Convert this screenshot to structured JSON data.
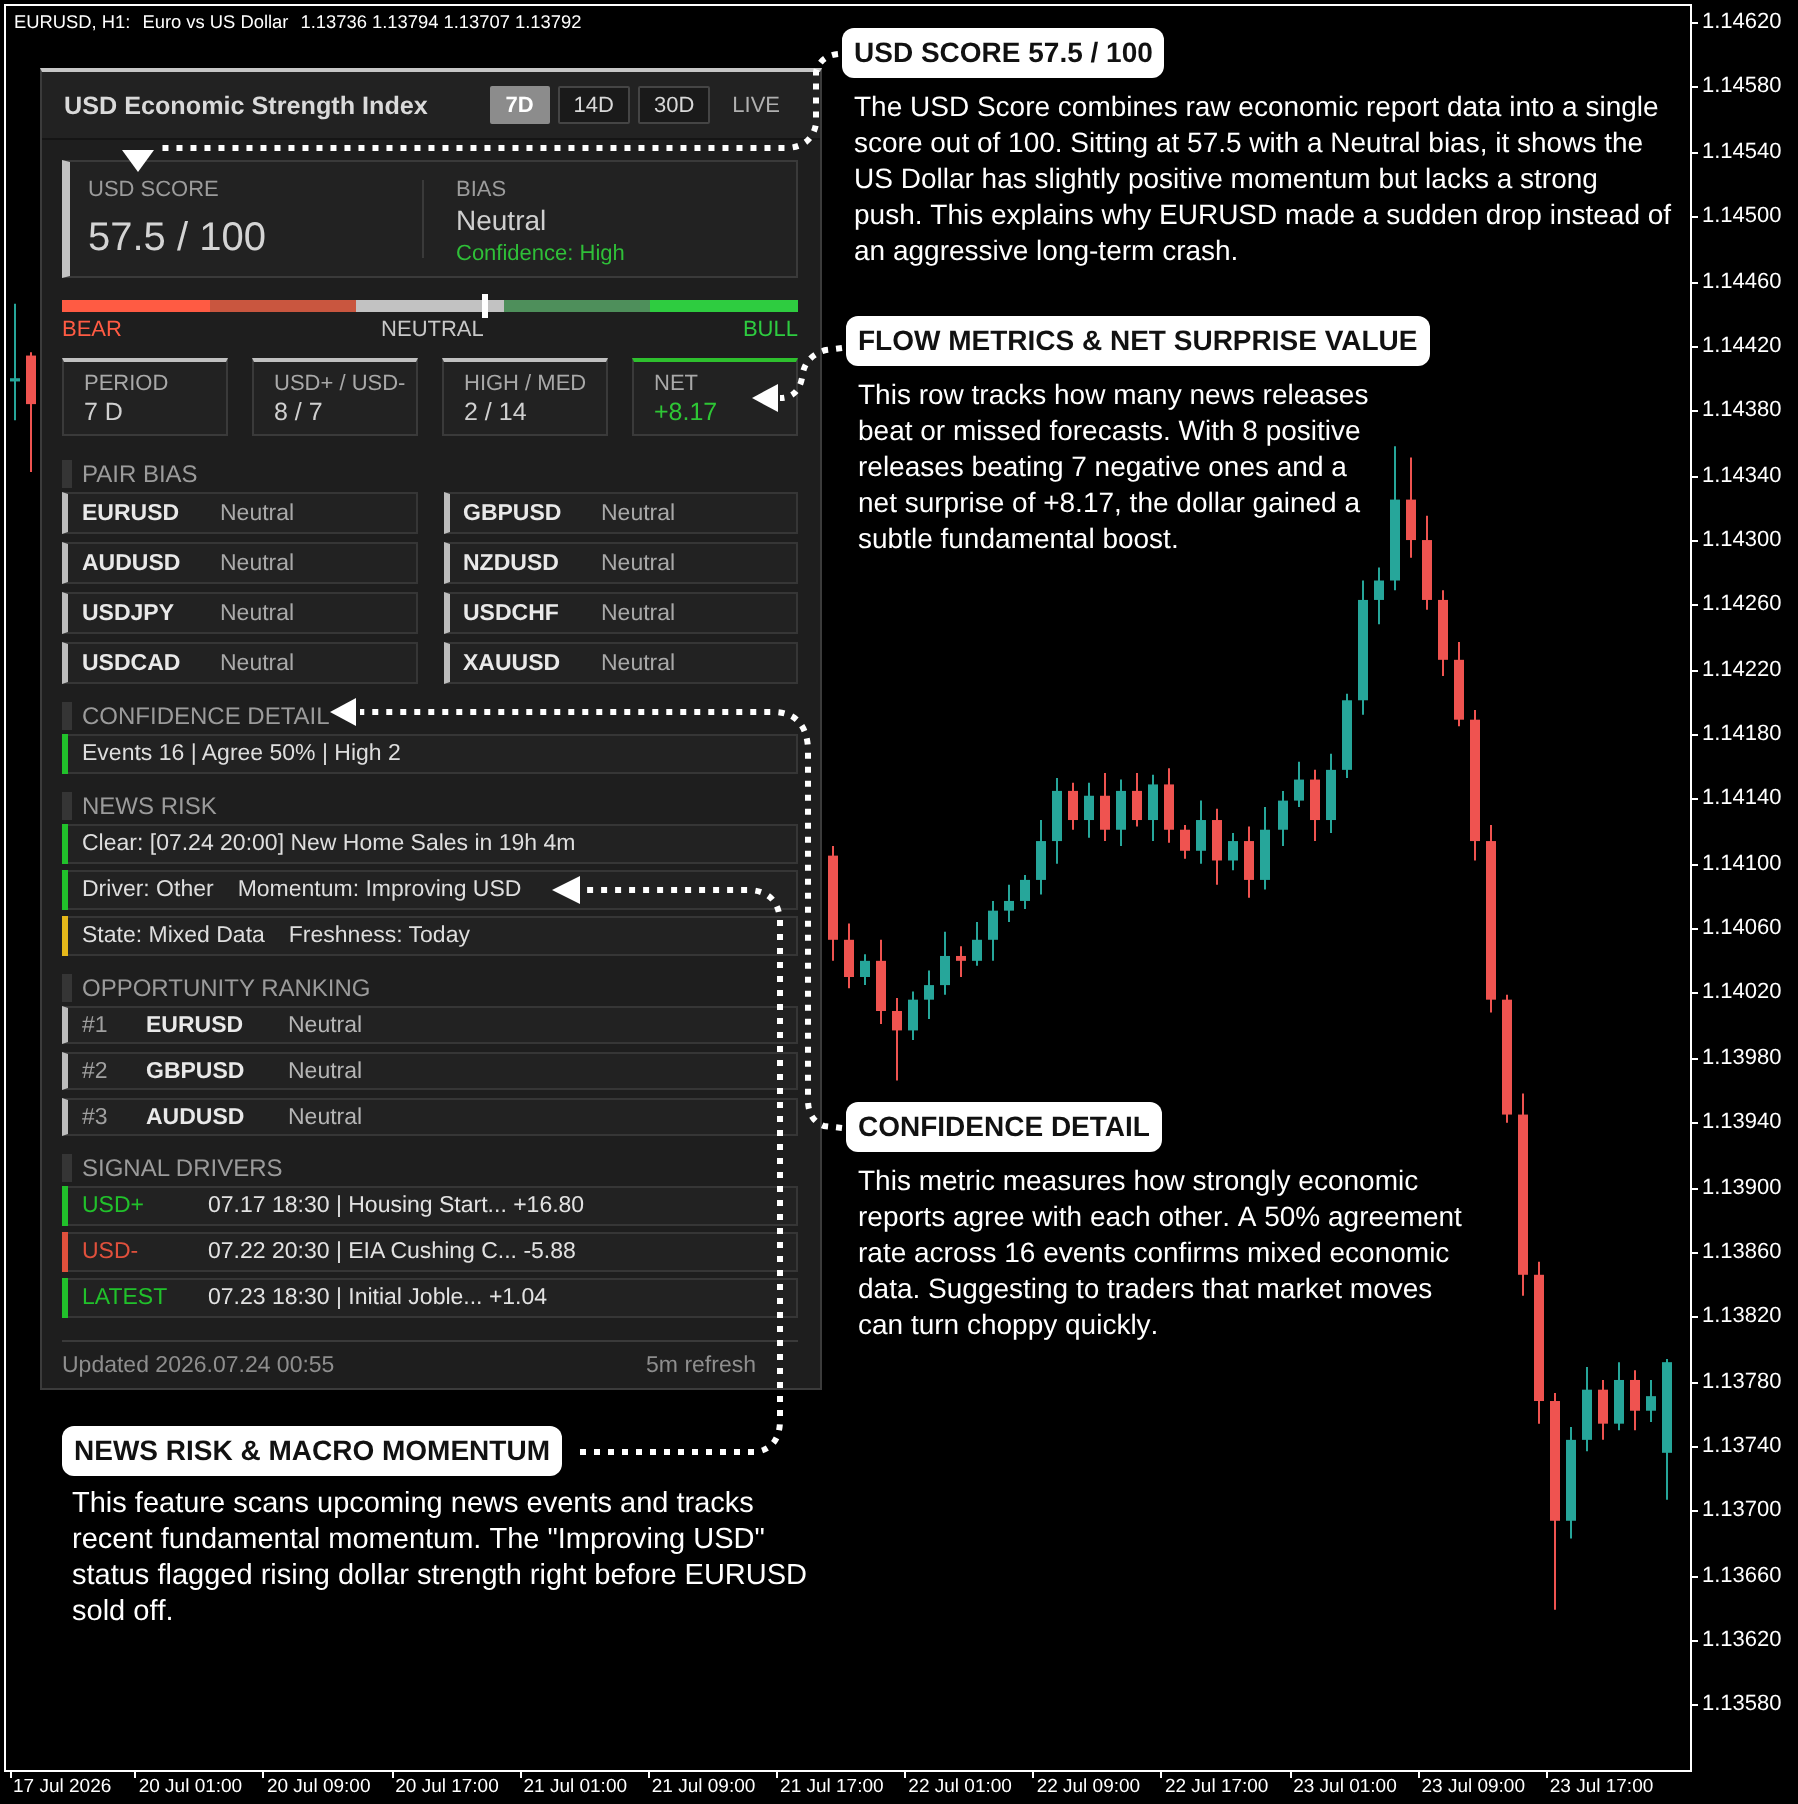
{
  "chart": {
    "symbol": "EURUSD, H1:",
    "description": "Euro vs US Dollar",
    "ohlc": "1.13736 1.13794 1.13707 1.13792",
    "chart_data": {
      "type": "candlestick",
      "categories": [
        null,
        null,
        null,
        "17 Jul 2026",
        null,
        null,
        null,
        null,
        null,
        null,
        null,
        "20 Jul 01:00",
        null,
        null,
        null,
        null,
        null,
        null,
        null,
        "20 Jul 09:00",
        null,
        null,
        null,
        null,
        null,
        null,
        null,
        "20 Jul 17:00",
        null,
        null,
        null,
        null,
        null,
        null,
        null,
        "21 Jul 01:00",
        null,
        null,
        null,
        null,
        null,
        null,
        null,
        "21 Jul 09:00",
        null,
        null,
        null,
        null,
        null,
        null,
        null,
        "21 Jul 17:00",
        null,
        null,
        null,
        null,
        null,
        null,
        null,
        "22 Jul 01:00",
        null,
        null,
        null,
        null,
        null,
        null,
        null,
        "22 Jul 09:00",
        null,
        null,
        null,
        null,
        null,
        null,
        null,
        "22 Jul 17:00",
        null,
        null,
        null,
        null,
        null,
        null,
        null,
        "23 Jul 01:00",
        null,
        null,
        null,
        null,
        null,
        null,
        null,
        "23 Jul 09:00",
        null,
        null,
        null,
        null,
        null,
        null,
        null,
        "23 Jul 17:00",
        null,
        null,
        null,
        null,
        null
      ],
      "ohlc": [
        [
          1.14398,
          1.14446,
          1.14374,
          1.144
        ],
        [
          1.14414,
          1.14416,
          1.14342,
          1.14384
        ],
        null,
        null,
        null,
        null,
        null,
        null,
        null,
        null,
        null,
        null,
        null,
        null,
        null,
        null,
        null,
        null,
        null,
        null,
        null,
        null,
        null,
        null,
        null,
        null,
        null,
        null,
        null,
        null,
        null,
        null,
        null,
        null,
        null,
        null,
        null,
        null,
        null,
        null,
        null,
        null,
        null,
        null,
        null,
        null,
        null,
        null,
        null,
        null,
        null,
        [
          1.14105,
          1.14111,
          1.1404,
          1.14053
        ],
        [
          1.14053,
          1.14063,
          1.14023,
          1.1403
        ],
        [
          1.1403,
          1.14044,
          1.14025,
          1.1404
        ],
        [
          1.1404,
          1.14053,
          1.14001,
          1.14009
        ],
        [
          1.14009,
          1.14017,
          1.13966,
          1.13997
        ],
        [
          1.13997,
          1.14021,
          1.13991,
          1.14016
        ],
        [
          1.14016,
          1.14034,
          1.14004,
          1.14025
        ],
        [
          1.14025,
          1.14058,
          1.14019,
          1.14043
        ],
        [
          1.14043,
          1.14049,
          1.1403,
          1.1404
        ],
        [
          1.1404,
          1.14064,
          1.14037,
          1.14053
        ],
        [
          1.14053,
          1.14077,
          1.1404,
          1.14071
        ],
        [
          1.14071,
          1.14087,
          1.14064,
          1.14077
        ],
        [
          1.14077,
          1.14093,
          1.14072,
          1.1409
        ],
        [
          1.1409,
          1.14127,
          1.14081,
          1.14114
        ],
        [
          1.14114,
          1.14153,
          1.141,
          1.14145
        ],
        [
          1.14145,
          1.1415,
          1.14121,
          1.14127
        ],
        [
          1.14127,
          1.1415,
          1.14116,
          1.14142
        ],
        [
          1.14142,
          1.14156,
          1.14114,
          1.14121
        ],
        [
          1.14121,
          1.14152,
          1.14111,
          1.14145
        ],
        [
          1.14145,
          1.14156,
          1.14123,
          1.14127
        ],
        [
          1.14127,
          1.14155,
          1.14114,
          1.14149
        ],
        [
          1.14149,
          1.14159,
          1.14113,
          1.14121
        ],
        [
          1.14121,
          1.14124,
          1.14103,
          1.14108
        ],
        [
          1.14108,
          1.14139,
          1.141,
          1.14127
        ],
        [
          1.14127,
          1.14134,
          1.14087,
          1.14102
        ],
        [
          1.14102,
          1.14119,
          1.14096,
          1.14114
        ],
        [
          1.14114,
          1.14123,
          1.14079,
          1.1409
        ],
        [
          1.1409,
          1.14135,
          1.14084,
          1.14121
        ],
        [
          1.14121,
          1.14145,
          1.14111,
          1.14139
        ],
        [
          1.14139,
          1.14163,
          1.14135,
          1.14152
        ],
        [
          1.14152,
          1.14158,
          1.14114,
          1.14127
        ],
        [
          1.14127,
          1.14168,
          1.14119,
          1.14158
        ],
        [
          1.14158,
          1.14205,
          1.14153,
          1.14201
        ],
        [
          1.14201,
          1.14275,
          1.14192,
          1.14263
        ],
        [
          1.14263,
          1.14283,
          1.14248,
          1.14275
        ],
        [
          1.14275,
          1.14358,
          1.14269,
          1.14325
        ],
        [
          1.14325,
          1.14351,
          1.14289,
          1.143
        ],
        [
          1.143,
          1.14315,
          1.14257,
          1.14263
        ],
        [
          1.14263,
          1.14269,
          1.14216,
          1.14226
        ],
        [
          1.14226,
          1.14237,
          1.14185,
          1.14189
        ],
        [
          1.14189,
          1.14195,
          1.14102,
          1.14114
        ],
        [
          1.14114,
          1.14124,
          1.14008,
          1.14016
        ],
        [
          1.14016,
          1.14019,
          1.1394,
          1.13945
        ],
        [
          1.13945,
          1.13958,
          1.13833,
          1.13846
        ],
        [
          1.13846,
          1.13854,
          1.13754,
          1.13768
        ],
        [
          1.13768,
          1.13773,
          1.13639,
          1.13694
        ],
        [
          1.13694,
          1.13752,
          1.13683,
          1.13744
        ],
        [
          1.13744,
          1.13789,
          1.13737,
          1.13775
        ],
        [
          1.13775,
          1.13781,
          1.13744,
          1.13754
        ],
        [
          1.13754,
          1.13792,
          1.1375,
          1.13781
        ],
        [
          1.13781,
          1.13787,
          1.1375,
          1.13762
        ],
        [
          1.13762,
          1.13781,
          1.13755,
          1.13771
        ],
        [
          1.13736,
          1.13794,
          1.13707,
          1.13792
        ],
        null
      ],
      "ylim": [
        1.1354,
        1.1463
      ],
      "yticks": [
        {
          "value": 1.1462,
          "label": "1.14620"
        },
        {
          "value": 1.1458,
          "label": "1.14580"
        },
        {
          "value": 1.1454,
          "label": "1.14540"
        },
        {
          "value": 1.145,
          "label": "1.14500"
        },
        {
          "value": 1.1446,
          "label": "1.14460"
        },
        {
          "value": 1.1442,
          "label": "1.14420"
        },
        {
          "value": 1.1438,
          "label": "1.14380"
        },
        {
          "value": 1.1434,
          "label": "1.14340"
        },
        {
          "value": 1.143,
          "label": "1.14300"
        },
        {
          "value": 1.1426,
          "label": "1.14260"
        },
        {
          "value": 1.1422,
          "label": "1.14220"
        },
        {
          "value": 1.1418,
          "label": "1.14180"
        },
        {
          "value": 1.1414,
          "label": "1.14140"
        },
        {
          "value": 1.141,
          "label": "1.14100"
        },
        {
          "value": 1.1406,
          "label": "1.14060"
        },
        {
          "value": 1.1402,
          "label": "1.14020"
        },
        {
          "value": 1.1398,
          "label": "1.13980"
        },
        {
          "value": 1.1394,
          "label": "1.13940"
        },
        {
          "value": 1.139,
          "label": "1.13900"
        },
        {
          "value": 1.1386,
          "label": "1.13860"
        },
        {
          "value": 1.1382,
          "label": "1.13820"
        },
        {
          "value": 1.1378,
          "label": "1.13780"
        },
        {
          "value": 1.1374,
          "label": "1.13740"
        },
        {
          "value": 1.137,
          "label": "1.13700"
        },
        {
          "value": 1.1366,
          "label": "1.13660"
        },
        {
          "value": 1.1362,
          "label": "1.13620"
        },
        {
          "value": 1.1358,
          "label": "1.13580"
        }
      ]
    }
  },
  "panel": {
    "title": "USD Economic Strength Index",
    "ranges": [
      {
        "label": "7D",
        "selected": true
      },
      {
        "label": "14D",
        "selected": false
      },
      {
        "label": "30D",
        "selected": false
      }
    ],
    "live": "LIVE",
    "score": {
      "label": "USD SCORE",
      "value": "57.5 / 100"
    },
    "bias": {
      "label": "BIAS",
      "value": "Neutral",
      "confidence": "Confidence: High"
    },
    "gauge": {
      "level": 0.575,
      "bear": "BEAR",
      "neutral": "NEUTRAL",
      "bull": "BULL"
    },
    "metrics": [
      {
        "label": "PERIOD",
        "value": "7 D",
        "kind": "plain"
      },
      {
        "label": "USD+ / USD-",
        "value": "8 / 7",
        "kind": "plain"
      },
      {
        "label": "HIGH / MED",
        "value": "2 / 14",
        "kind": "plain"
      },
      {
        "label": "NET",
        "value": "+8.17",
        "kind": "positive"
      }
    ],
    "pair_bias": {
      "heading": "PAIR BIAS",
      "pairs": [
        {
          "pair": "EURUSD",
          "bias": "Neutral"
        },
        {
          "pair": "GBPUSD",
          "bias": "Neutral"
        },
        {
          "pair": "AUDUSD",
          "bias": "Neutral"
        },
        {
          "pair": "NZDUSD",
          "bias": "Neutral"
        },
        {
          "pair": "USDJPY",
          "bias": "Neutral"
        },
        {
          "pair": "USDCHF",
          "bias": "Neutral"
        },
        {
          "pair": "USDCAD",
          "bias": "Neutral"
        },
        {
          "pair": "XAUUSD",
          "bias": "Neutral"
        }
      ]
    },
    "confidence_detail": {
      "heading": "CONFIDENCE DETAIL",
      "rows": [
        {
          "texts": [
            "Events 16 | Agree 50% | High 2"
          ],
          "color": "#21c12b"
        }
      ]
    },
    "news_risk": {
      "heading": "NEWS RISK",
      "rows": [
        {
          "texts": [
            "Clear: [07.24 20:00] New Home Sales in 19h 4m"
          ],
          "color": "#21c12b"
        },
        {
          "texts": [
            "Driver: Other",
            "Momentum: Improving USD"
          ],
          "color": "#21c12b"
        },
        {
          "texts": [
            "State: Mixed Data",
            "Freshness: Today"
          ],
          "color": "#e5b81a"
        }
      ]
    },
    "opportunity_ranking": {
      "heading": "OPPORTUNITY RANKING",
      "rows": [
        {
          "rank": "#1",
          "pair": "EURUSD",
          "bias": "Neutral"
        },
        {
          "rank": "#2",
          "pair": "GBPUSD",
          "bias": "Neutral"
        },
        {
          "rank": "#3",
          "pair": "AUDUSD",
          "bias": "Neutral"
        }
      ]
    },
    "signal_drivers": {
      "heading": "SIGNAL DRIVERS",
      "rows": [
        {
          "tag": "USD+",
          "detail": "07.17 18:30 | Housing Start... +16.80",
          "color": "#21c12b"
        },
        {
          "tag": "USD-",
          "detail": "07.22 20:30 | EIA Cushing C... -5.88",
          "color": "#e0503c"
        },
        {
          "tag": "LATEST",
          "detail": "07.23 18:30 | Initial Joble... +1.04",
          "color": "#21c12b"
        }
      ]
    },
    "footer": {
      "updated": "Updated 2026.07.24 00:55",
      "refresh": "5m refresh"
    }
  },
  "callouts": [
    {
      "title": "USD SCORE 57.5 / 100",
      "body": "The USD Score combines raw economic report data into a single score out of 100. Sitting at 57.5 with a Neutral bias, it shows the US Dollar has slightly positive momentum but lacks a strong push. This explains why EURUSD made a sudden drop instead of an aggressive long-term crash."
    },
    {
      "title": "FLOW METRICS & NET SURPRISE VALUE",
      "body": "This row tracks how many news releases beat or missed forecasts. With 8 positive releases beating 7 negative ones and a net surprise of +8.17, the dollar gained a subtle fundamental boost."
    },
    {
      "title": "CONFIDENCE DETAIL",
      "body": "This metric measures how strongly economic reports agree with each other. A 50% agreement rate across 16 events confirms mixed economic data. Suggesting to traders that market moves can turn choppy quickly."
    },
    {
      "title": "NEWS RISK & MACRO MOMENTUM",
      "body": "This feature scans upcoming news events and tracks recent fundamental momentum. The \"Improving USD\" status flagged rising dollar strength right before EURUSD sold off."
    }
  ]
}
